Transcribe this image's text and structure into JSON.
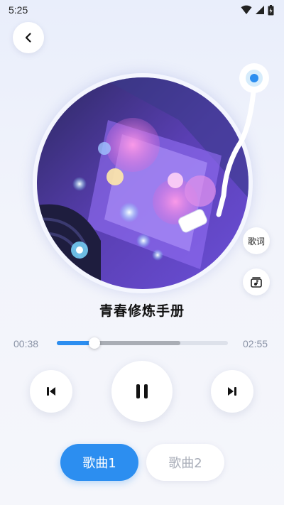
{
  "status_bar": {
    "time": "5:25",
    "icons": [
      "wifi-icon",
      "signal-icon",
      "battery-icon"
    ]
  },
  "nav": {
    "back_icon": "chevron-left-icon"
  },
  "player": {
    "song_title": "青春修炼手册",
    "current_time": "00:38",
    "total_time": "02:55",
    "progress": 0.22,
    "buffered": 0.72,
    "lyrics_label": "歌词",
    "music_icon": "music-folder-icon",
    "state": "playing"
  },
  "controls": {
    "prev_icon": "skip-previous-icon",
    "play_pause_icon": "pause-icon",
    "next_icon": "skip-next-icon"
  },
  "tabs": [
    {
      "label": "歌曲1",
      "active": true
    },
    {
      "label": "歌曲2",
      "active": false
    }
  ],
  "colors": {
    "accent": "#2c8ef0",
    "background": "#eef1fb",
    "track": "#dde1ea"
  }
}
